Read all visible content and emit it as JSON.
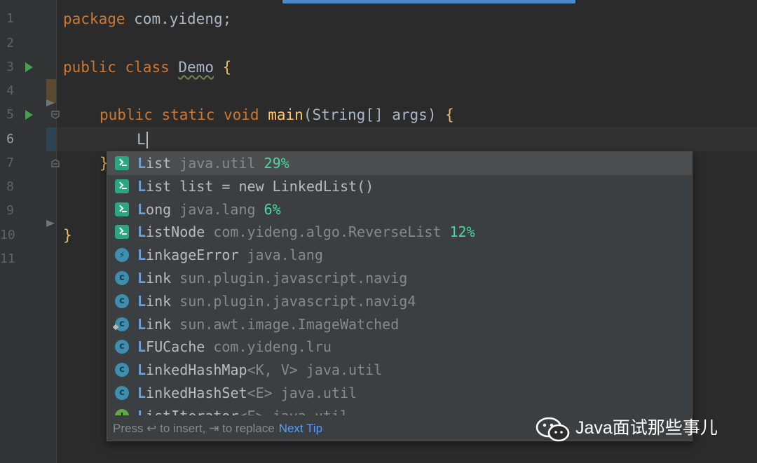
{
  "editor": {
    "line_numbers": [
      "1",
      "2",
      "3",
      "4",
      "5",
      "6",
      "7",
      "8",
      "9",
      "10",
      "11"
    ],
    "code": {
      "line1": {
        "kw": "package",
        "rest": " com.yideng;"
      },
      "line3": {
        "kw1": "public",
        "kw2": "class",
        "cls": "Demo",
        "brace": "{"
      },
      "line5": {
        "kws": "public static void",
        "fn": "main",
        "params": "(String[] args) ",
        "brace": "{"
      },
      "line6": {
        "typed": "L"
      },
      "line7": {
        "brace": "}"
      },
      "line10": {
        "brace": "}"
      }
    }
  },
  "completion_popup": {
    "items": [
      {
        "icon": "live-template-icon",
        "match": "L",
        "name": "ist",
        "generic": "",
        "location": "java.util",
        "percent": "29%",
        "selected": true
      },
      {
        "icon": "live-template-icon",
        "match": "L",
        "name": "ist list = new LinkedList()",
        "generic": "",
        "location": "",
        "percent": "",
        "selected": false
      },
      {
        "icon": "live-template-icon",
        "match": "L",
        "name": "ong",
        "generic": "",
        "location": "java.lang",
        "percent": "6%",
        "selected": false
      },
      {
        "icon": "live-template-icon",
        "match": "L",
        "name": "istNode",
        "generic": "",
        "location": "com.yideng.algo.ReverseList",
        "percent": "12%",
        "selected": false
      },
      {
        "icon": "exception-class-icon",
        "match": "L",
        "name": "inkageError",
        "generic": "",
        "location": "java.lang",
        "percent": "",
        "selected": false
      },
      {
        "icon": "class-icon",
        "match": "L",
        "name": "ink",
        "generic": "",
        "location": "sun.plugin.javascript.navig",
        "percent": "",
        "selected": false
      },
      {
        "icon": "class-icon",
        "match": "L",
        "name": "ink",
        "generic": "",
        "location": "sun.plugin.javascript.navig4",
        "percent": "",
        "selected": false
      },
      {
        "icon": "class-icon",
        "match": "L",
        "name": "ink",
        "generic": "",
        "location": "sun.awt.image.ImageWatched",
        "percent": "",
        "selected": false
      },
      {
        "icon": "class-icon",
        "match": "L",
        "name": "FUCache",
        "generic": "",
        "location": "com.yideng.lru",
        "percent": "",
        "selected": false
      },
      {
        "icon": "class-icon",
        "match": "L",
        "name": "inkedHashMap",
        "generic": "<K, V>",
        "location": "java.util",
        "percent": "",
        "selected": false
      },
      {
        "icon": "class-icon",
        "match": "L",
        "name": "inkedHashSet",
        "generic": "<E>",
        "location": "java.util",
        "percent": "",
        "selected": false
      },
      {
        "icon": "interface-icon",
        "match": "L",
        "name": "istIterator",
        "generic": "<E>",
        "location": "java.util",
        "percent": "",
        "selected": false
      }
    ],
    "footer": {
      "hint": "Press ↩ to insert, ⇥ to replace",
      "next_tip": "Next Tip"
    }
  },
  "watermark": {
    "icon": "wechat-icon",
    "text": "Java面试那些事儿"
  }
}
